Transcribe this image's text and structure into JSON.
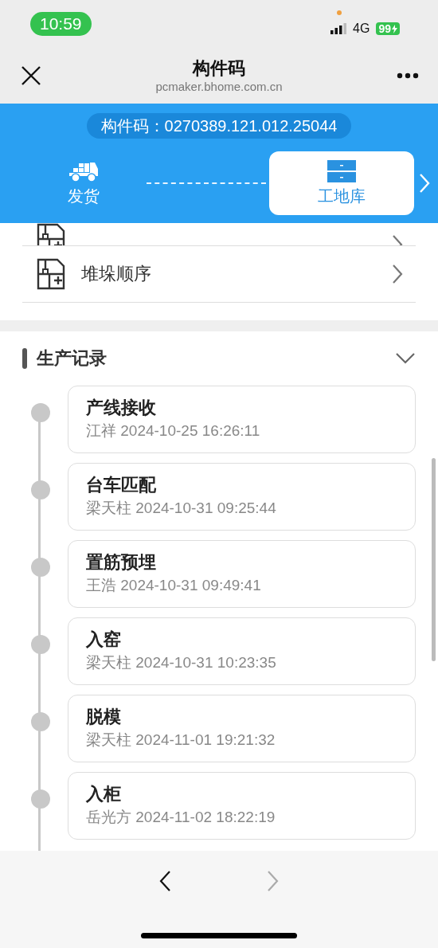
{
  "status_bar": {
    "time": "10:59",
    "network": "4G",
    "battery": "99"
  },
  "nav": {
    "title": "构件码",
    "subtitle": "pcmaker.bhome.com.cn"
  },
  "code": "构件码：0270389.121.012.25044",
  "steps": [
    {
      "label": "发货",
      "kind": "truck",
      "selected": false
    },
    {
      "label": "工地库",
      "kind": "storage",
      "selected": true
    }
  ],
  "menu": [
    {
      "kind": "partial"
    },
    {
      "label": "堆垛顺序",
      "kind": "full"
    }
  ],
  "section": {
    "title": "生产记录",
    "expanded": true
  },
  "records": [
    {
      "title": "产线接收",
      "detail": "江祥 2024-10-25 16:26:11"
    },
    {
      "title": "台车匹配",
      "detail": "梁天柱 2024-10-31 09:25:44"
    },
    {
      "title": "置筋预埋",
      "detail": "王浩 2024-10-31 09:49:41"
    },
    {
      "title": "入窑",
      "detail": "梁天柱 2024-10-31 10:23:35"
    },
    {
      "title": "脱模",
      "detail": "梁天柱 2024-11-01 19:21:32"
    },
    {
      "title": "入柜",
      "detail": "岳光方 2024-11-02 18:22:19"
    }
  ],
  "toolbar": {
    "back_disabled": false,
    "forward_disabled": true
  }
}
